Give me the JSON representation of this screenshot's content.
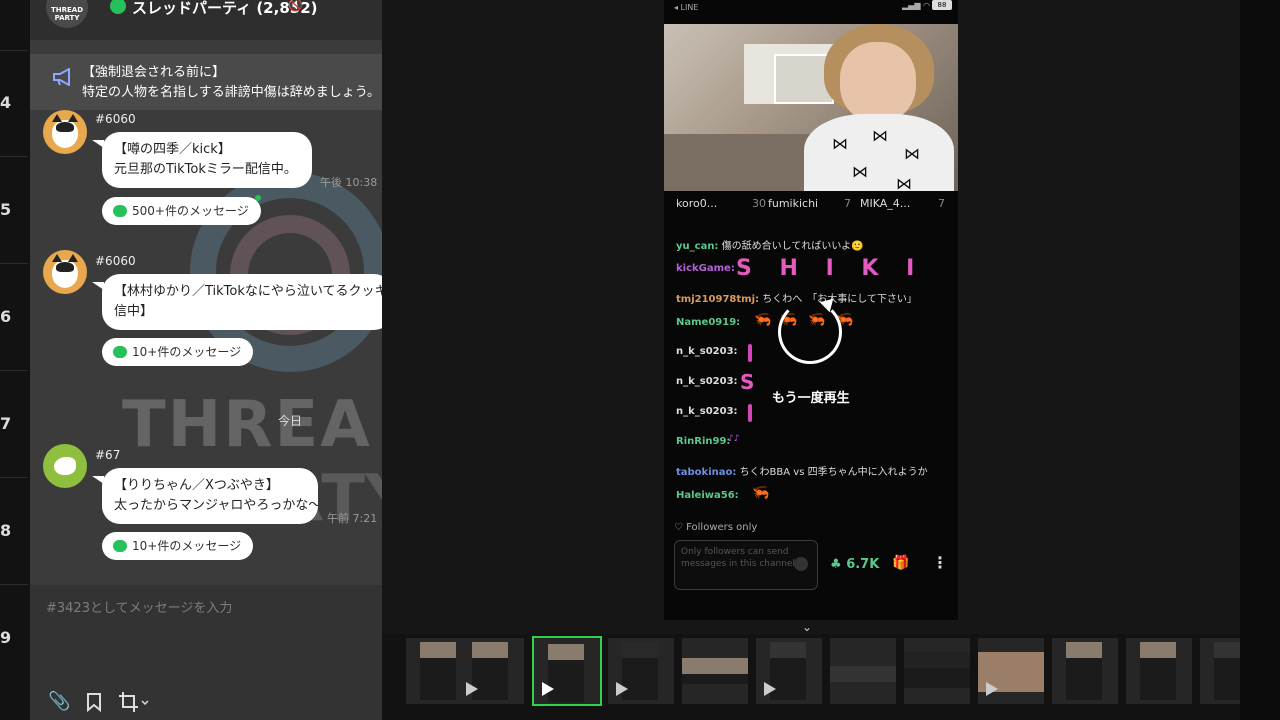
{
  "left_strip": {
    "numbers": [
      "4",
      "5",
      "6",
      "7",
      "8",
      "9"
    ]
  },
  "chat": {
    "header": {
      "logo_text": "THREAD PARTY",
      "title": "スレッドパーティ (2,852)",
      "mute_icon": "mute-icon"
    },
    "notice": {
      "title": "【強制退会される前に】",
      "text": "特定の人物を名指しする誹謗中傷は辞めましょう。"
    },
    "watermark": {
      "line1": "THREA",
      "line2": "RTY"
    },
    "today_label": "今日",
    "messages": [
      {
        "id": "#6060",
        "lines": [
          "【噂の四季／kick】",
          "元旦那のTikTokミラー配信中。"
        ],
        "thread_count": "500+件のメッセージ",
        "time": "午後 10:38"
      },
      {
        "id": "#6060",
        "lines": [
          "【林村ゆかり／TikTokなにやら泣いてるクッキー",
          "信中】"
        ],
        "thread_count": "10+件のメッセージ",
        "time": ""
      },
      {
        "id": "#67",
        "lines": [
          "【りりちゃん／Xつぶやき】",
          "太ったからマンジャロやろっかな〜"
        ],
        "thread_count": "10+件のメッセージ",
        "time": "午前 7:21"
      }
    ],
    "input_placeholder": "#3423としてメッセージを入力",
    "toolbar": {
      "attach_icon": "paperclip-icon",
      "bookmark_icon": "bookmark-icon",
      "crop_icon": "crop-icon"
    }
  },
  "phone": {
    "status_app": "◂ LINE",
    "battery": "88",
    "viewers": [
      {
        "name": "koro0...",
        "count": "30"
      },
      {
        "name": "fumikichi",
        "count": "7"
      },
      {
        "name": "MIKA_4...",
        "count": "7"
      }
    ],
    "comments": [
      {
        "user": "yu_can:",
        "text": "傷の舐め合いしてればいいよ🙂",
        "color": "#5ac98b"
      },
      {
        "user": "kickGame:",
        "text": "",
        "color": "#b562d9"
      },
      {
        "user": "tmj210978tmj:",
        "text": "ちくわへ　「お大事にして下さい」",
        "color": "#d99a5a"
      },
      {
        "user": "Name0919:",
        "text": "",
        "color": "#5ac98b"
      },
      {
        "user": "n_k_s0203:",
        "text": "",
        "color": "#dddddd"
      },
      {
        "user": "n_k_s0203:",
        "text": "",
        "color": "#dddddd"
      },
      {
        "user": "n_k_s0203:",
        "text": "",
        "color": "#dddddd"
      },
      {
        "user": "RinRin99:",
        "text": "",
        "color": "#5ac98b"
      },
      {
        "user": "tabokinao:",
        "text": "ちくわBBA vs 四季ちゃん中に入れようか",
        "color": "#6f8fdd"
      },
      {
        "user": "Haleiwa56:",
        "text": "",
        "color": "#5ac98b"
      }
    ],
    "shiki_letters": "S H I K I",
    "emote_s": "S",
    "replay_label": "もう一度再生",
    "followers_only": "♡ Followers only",
    "input_placeholder": "Only followers can send messages in this channel",
    "likes": "6.7K",
    "gift_icon": "gift-icon",
    "more_icon": "more-vertical-icon"
  },
  "filmstrip": {
    "toggle_icon": "chevron-double-down-icon",
    "thumb_count_visible": 12
  },
  "colors": {
    "accent_green": "#2fd34b",
    "line_green": "#27c15b"
  }
}
